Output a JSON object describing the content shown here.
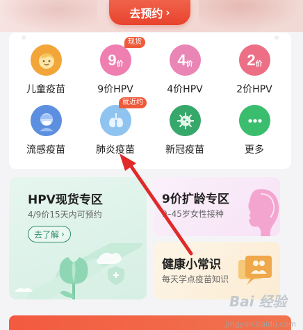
{
  "banner": {
    "book_label": "去预约",
    "book_chevron": "›"
  },
  "vaccines": [
    {
      "label": "儿童疫苗",
      "icon": "child-face-icon",
      "color": "#f2a63a"
    },
    {
      "label": "9价HPV",
      "icon": "nine-valent-icon",
      "color": "#ee7fb0",
      "num": "9",
      "unit": "价",
      "tag": "现货"
    },
    {
      "label": "4价HPV",
      "icon": "four-valent-icon",
      "color": "#ea86b5",
      "num": "4",
      "unit": "价"
    },
    {
      "label": "2价HPV",
      "icon": "two-valent-icon",
      "color": "#ec6f86",
      "num": "2",
      "unit": "价"
    },
    {
      "label": "流感疫苗",
      "icon": "flu-person-icon",
      "color": "#5d8fe0"
    },
    {
      "label": "肺炎疫苗",
      "icon": "lungs-icon",
      "color": "#8fc4f0",
      "tag": "就近约"
    },
    {
      "label": "新冠疫苗",
      "icon": "virus-icon",
      "color": "#37a86b"
    },
    {
      "label": "更多",
      "icon": "more-dots-icon",
      "color": "#3bbd6e"
    }
  ],
  "hpv_zone": {
    "title": "HPV现货专区",
    "subtitle": "4/9价15天内可预约",
    "button": "去了解",
    "button_chevron": "›"
  },
  "age_zone": {
    "title": "9价扩龄专区",
    "subtitle": "9–45岁女性接种"
  },
  "tips": {
    "title": "健康小常识",
    "subtitle": "每天学点疫苗知识"
  },
  "watermark": {
    "logo": "Bai 经验",
    "url": "jingyan.baidu.com"
  }
}
